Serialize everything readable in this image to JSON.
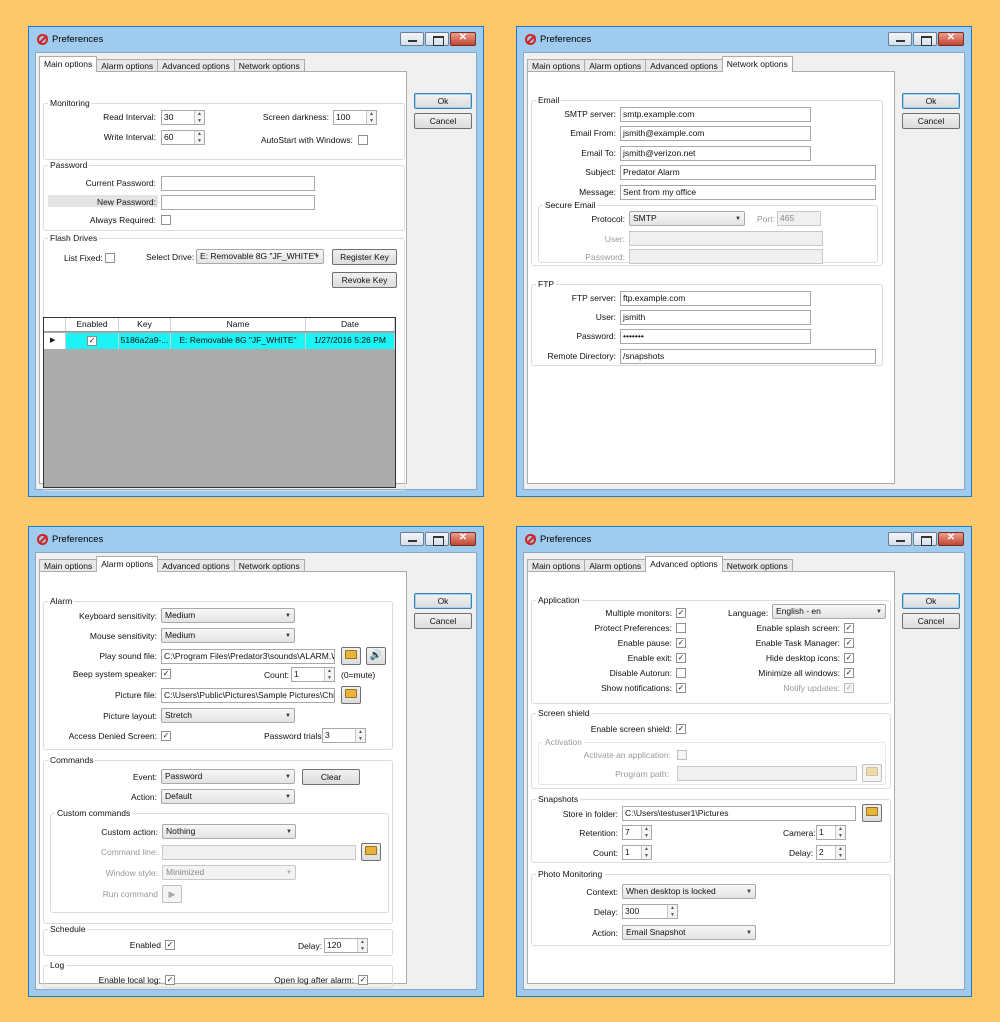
{
  "window_title": "Preferences",
  "tabs": [
    "Main options",
    "Alarm options",
    "Advanced options",
    "Network options"
  ],
  "buttons": {
    "ok": "Ok",
    "cancel": "Cancel"
  },
  "main": {
    "monitoring": {
      "title": "Monitoring",
      "read_interval_label": "Read Interval:",
      "read_interval": "30",
      "write_interval_label": "Write Interval:",
      "write_interval": "60",
      "screen_darkness_label": "Screen darkness:",
      "screen_darkness": "100",
      "autostart_label": "AutoStart with Windows:",
      "autostart": false
    },
    "password": {
      "title": "Password",
      "current_label": "Current Password:",
      "current": "",
      "new_label": "New Password:",
      "new": "",
      "always_label": "Always Required:",
      "always": false
    },
    "flash": {
      "title": "Flash Drives",
      "list_fixed_label": "List Fixed:",
      "list_fixed": false,
      "select_drive_label": "Select Drive:",
      "select_drive": "E: Removable 8G \"JF_WHITE\"",
      "register_label": "Register Key",
      "revoke_label": "Revoke Key",
      "columns": [
        "Enabled",
        "Key",
        "Name",
        "Date"
      ],
      "rows": [
        {
          "enabled": true,
          "key": "5186a2a9-...",
          "name": "E: Removable 8G \"JF_WHITE\"",
          "date": "1/27/2016 5:26 PM"
        }
      ]
    }
  },
  "network": {
    "email": {
      "title": "Email",
      "smtp_label": "SMTP server:",
      "smtp": "smtp.example.com",
      "from_label": "Email From:",
      "from": "jsmith@example.com",
      "to_label": "Email To:",
      "to": "jsmith@verizon.net",
      "subject_label": "Subject:",
      "subject": "Predator Alarm",
      "message_label": "Message:",
      "message": "Sent from my office"
    },
    "secure": {
      "title": "Secure Email",
      "protocol_label": "Protocol:",
      "protocol": "SMTP",
      "port_label": "Port:",
      "port": "465",
      "user_label": "User:",
      "user": "",
      "password_label": "Password:",
      "password": ""
    },
    "ftp": {
      "title": "FTP",
      "server_label": "FTP server:",
      "server": "ftp.example.com",
      "user_label": "User:",
      "user": "jsmith",
      "password_label": "Password:",
      "password": "•••••••",
      "dir_label": "Remote Directory:",
      "dir": "/snapshots"
    }
  },
  "alarm": {
    "alarm": {
      "title": "Alarm",
      "keyboard_label": "Keyboard sensitivity:",
      "keyboard": "Medium",
      "mouse_label": "Mouse sensitivity:",
      "mouse": "Medium",
      "sound_label": "Play sound file:",
      "sound": "C:\\Program Files\\Predator3\\sounds\\ALARM.W...",
      "beep_label": "Beep system speaker:",
      "beep": true,
      "count_label": "Count:",
      "count": "1",
      "mute_hint": "(0=mute)",
      "picture_label": "Picture file:",
      "picture": "C:\\Users\\Public\\Pictures\\Sample Pictures\\Chry",
      "layout_label": "Picture layout:",
      "layout": "Stretch",
      "denied_label": "Access Denied Screen:",
      "denied": true,
      "trials_label": "Password trials:",
      "trials": "3"
    },
    "commands": {
      "title": "Commands",
      "event_label": "Event:",
      "event": "Password",
      "clear_label": "Clear",
      "action_label": "Action:",
      "action": "Default",
      "custom": {
        "title": "Custom commands",
        "custom_action_label": "Custom action:",
        "custom_action": "Nothing",
        "command_line_label": "Command line:",
        "command_line": "",
        "window_style_label": "Window style:",
        "window_style": "Minimized",
        "run_label": "Run command"
      }
    },
    "schedule": {
      "title": "Schedule",
      "enabled_label": "Enabled",
      "enabled": true,
      "delay_label": "Delay:",
      "delay": "120"
    },
    "log": {
      "title": "Log",
      "local_label": "Enable local log:",
      "local": true,
      "open_label": "Open log after alarm:",
      "open": true
    }
  },
  "advanced": {
    "application": {
      "title": "Application",
      "multiple_label": "Multiple monitors:",
      "multiple": true,
      "protect_label": "Protect Preferences:",
      "protect": false,
      "pause_label": "Enable pause:",
      "pause": true,
      "exit_label": "Enable exit:",
      "exit": true,
      "autorun_label": "Disable Autorun:",
      "autorun": false,
      "notifications_label": "Show notifications:",
      "notifications": true,
      "language_label": "Language:",
      "language": "English - en",
      "splash_label": "Enable splash screen:",
      "splash": true,
      "taskmgr_label": "Enable Task Manager:",
      "taskmgr": true,
      "hide_icons_label": "Hide desktop icons:",
      "hide_icons": true,
      "minimize_label": "Minimize all windows:",
      "minimize": true,
      "notify_updates_label": "Notify updates:",
      "notify_updates": true
    },
    "shield": {
      "title": "Screen shield",
      "enable_label": "Enable screen shield:",
      "enable": true,
      "activation_title": "Activation",
      "activate_app_label": "Activate an application:",
      "activate_app": false,
      "program_path_label": "Program path:",
      "program_path": ""
    },
    "snapshots": {
      "title": "Snapshots",
      "folder_label": "Store in folder:",
      "folder": "C:\\Users\\testuser1\\Pictures",
      "retention_label": "Retention:",
      "retention": "7",
      "count_label": "Count:",
      "count": "1",
      "camera_label": "Camera:",
      "camera": "1",
      "delay_label": "Delay:",
      "delay": "2"
    },
    "photo": {
      "title": "Photo Monitoring",
      "context_label": "Context:",
      "context": "When desktop is locked",
      "delay_label": "Delay:",
      "delay": "300",
      "action_label": "Action:",
      "action": "Email Snapshot"
    }
  }
}
